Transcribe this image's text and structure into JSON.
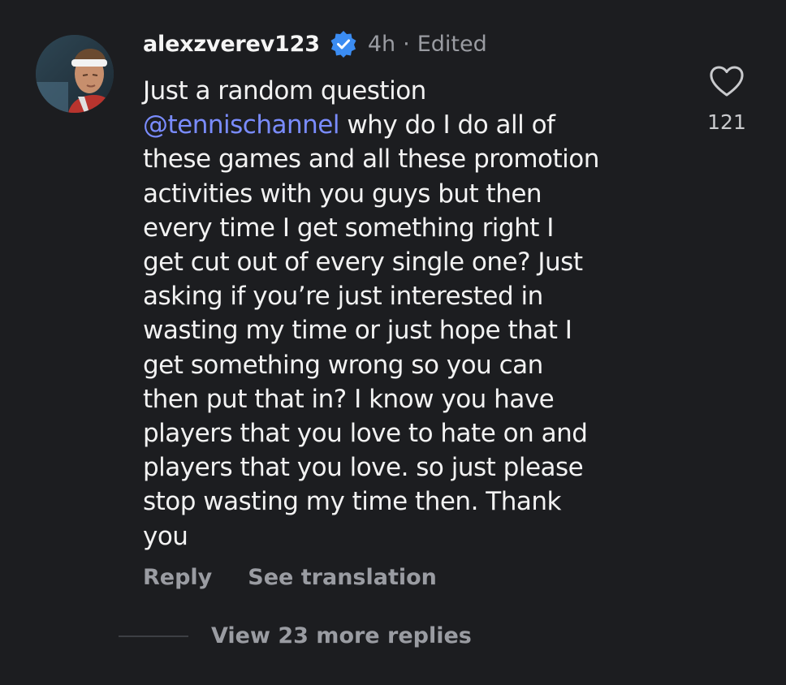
{
  "comment": {
    "username": "alexzverev123",
    "verified_icon": "verified-badge-icon",
    "time": "4h",
    "separator": "·",
    "edited": "Edited",
    "body": {
      "line1": "Just a random question",
      "mention": "@tennischannel",
      "line2_rest": " why do I do all of",
      "line3": "these games and all these promotion",
      "line4": "activities with you guys but then",
      "line5": "every time I get something right I",
      "line6": "get cut out of every single one? Just",
      "line7": "asking if you’re just interested in",
      "line8": "wasting my time or just hope that I",
      "line9": "get something wrong so you can",
      "line10": "then put that in? I know you have",
      "line11": "players that you love to hate on and",
      "line12": "players that you love. so just please",
      "line13": "stop wasting my time then. Thank",
      "line14": "you"
    },
    "actions": {
      "reply": "Reply",
      "see_translation": "See translation"
    },
    "likes": {
      "icon": "heart-icon",
      "count": "121"
    },
    "view_more": "View 23 more replies"
  },
  "colors": {
    "background": "#1c1d20",
    "text": "#f2f2f2",
    "muted": "#9a9ca2",
    "mention": "#7a8cff",
    "verified": "#3b8cf2"
  }
}
